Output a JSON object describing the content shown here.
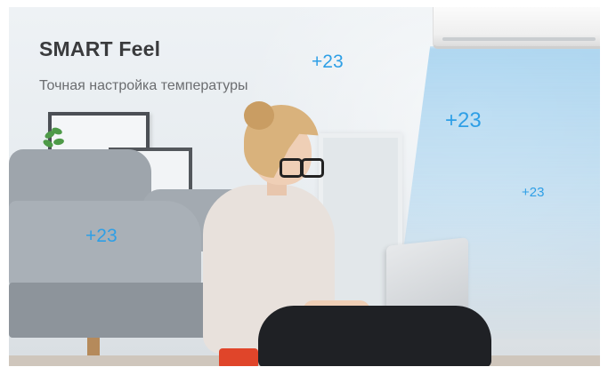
{
  "banner": {
    "title": "SMART Feel",
    "subtitle": "Точная настройка температуры",
    "accent_color": "#2e9fe6",
    "temperature_labels": [
      "+23",
      "+23",
      "+23",
      "+23"
    ]
  },
  "scene": {
    "elements": [
      "air-conditioner",
      "cool-airflow",
      "sofa",
      "woman-with-glasses",
      "laptop",
      "picture-frames",
      "plant",
      "red-mug"
    ]
  }
}
